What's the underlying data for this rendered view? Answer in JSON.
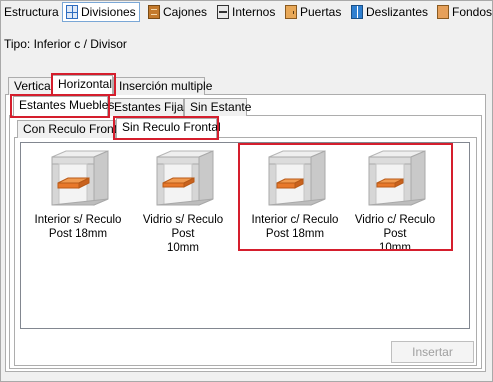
{
  "toolbar": {
    "items": [
      {
        "label": "Estructura",
        "icon": ""
      },
      {
        "label": "Divisiones",
        "icon": "grid-icon"
      },
      {
        "label": "Cajones",
        "icon": "drawer-icon"
      },
      {
        "label": "Internos",
        "icon": "interior-icon"
      },
      {
        "label": "Puertas",
        "icon": "door-icon"
      },
      {
        "label": "Deslizantes",
        "icon": "sliding-door-icon"
      },
      {
        "label": "Fondos",
        "icon": "back-panel-icon"
      }
    ],
    "active": "Divisiones"
  },
  "tipo": "Tipo: Inferior c / Divisor",
  "tabs_level1": [
    "Vertical",
    "Horizontal",
    "Inserción multiple"
  ],
  "tabs_level1_selected": "Horizontal",
  "tabs_level2": [
    "Estantes Muebles",
    "Estantes Fijas",
    "Sin Estante"
  ],
  "tabs_level2_selected": "Estantes Muebles",
  "tabs_level3": [
    "Con Reculo Frontal",
    "Sin Reculo Frontal"
  ],
  "tabs_level3_selected": "Sin Reculo Frontal",
  "items": [
    {
      "line1": "Interior s/ Reculo",
      "line2": "Post 18mm"
    },
    {
      "line1": "Vidrio s/ Reculo Post",
      "line2": "10mm"
    },
    {
      "line1": "Interior c/ Reculo",
      "line2": "Post 18mm"
    },
    {
      "line1": "Vidrio c/ Reculo Post",
      "line2": "10mm"
    }
  ],
  "insert_button": "Insertar",
  "colors": {
    "highlight": "#d51e2d",
    "shelf": "#e8782a",
    "cabinet": "#d9d9d9"
  }
}
